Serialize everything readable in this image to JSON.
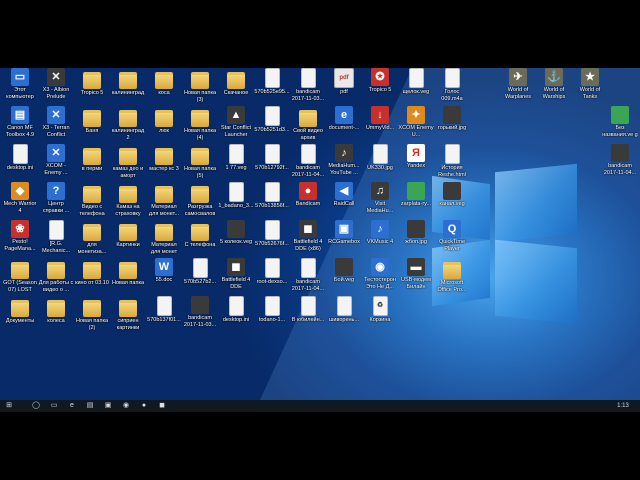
{
  "desktop": {
    "icons": [
      {
        "label": "Этот компьютер",
        "name": "this-pc-icon",
        "glyph": "▭",
        "style": "g-app"
      },
      {
        "label": "X3 - Albion Prelude",
        "name": "x3-albion-icon",
        "glyph": "✕",
        "style": "g-dark"
      },
      {
        "label": "Tropico 5",
        "name": "tropico5-shortcut-icon",
        "glyph": "",
        "style": "g-folder"
      },
      {
        "label": "калининград",
        "name": "folder-icon",
        "glyph": "",
        "style": "g-folder"
      },
      {
        "label": "коса",
        "name": "folder-icon",
        "glyph": "",
        "style": "g-folder"
      },
      {
        "label": "Новая папка (3)",
        "name": "folder-icon",
        "glyph": "",
        "style": "g-folder"
      },
      {
        "label": "Скачаное",
        "name": "folder-icon",
        "glyph": "",
        "style": "g-folder"
      },
      {
        "label": "570b525e95...",
        "name": "file-icon",
        "glyph": "",
        "style": "g-file"
      },
      {
        "label": "bandicam 2017-11-03...",
        "name": "video-file-icon",
        "glyph": "",
        "style": "g-file"
      },
      {
        "label": "pdf",
        "name": "pdf-file-icon",
        "glyph": "pdf",
        "style": "g-pdf"
      },
      {
        "label": "Tropico 5",
        "name": "tropico5-icon",
        "glyph": "✪",
        "style": "g-red"
      },
      {
        "label": "щелок.veg",
        "name": "veg-file-icon",
        "glyph": "",
        "style": "g-file"
      },
      {
        "label": "Голос 009.m4a",
        "name": "audio-file-icon",
        "glyph": "",
        "style": "g-file"
      },
      {
        "label": "World of Warplanes",
        "name": "wowp-icon",
        "glyph": "✈",
        "style": "g-wot"
      },
      {
        "label": "World of Warships",
        "name": "wows-icon",
        "glyph": "⚓",
        "style": "g-wot"
      },
      {
        "label": "World of Tanks",
        "name": "wot-icon",
        "glyph": "★",
        "style": "g-wot"
      },
      {
        "label": "Canon MF Toolbox 4.9",
        "name": "canon-icon",
        "glyph": "▤",
        "style": "g-app"
      },
      {
        "label": "X3 - Terran Conflict",
        "name": "x3-terran-icon",
        "glyph": "✕",
        "style": "g-app"
      },
      {
        "label": "Баня",
        "name": "folder-icon",
        "glyph": "",
        "style": "g-folder"
      },
      {
        "label": "калининград 2",
        "name": "folder-icon",
        "glyph": "",
        "style": "g-folder"
      },
      {
        "label": "люк",
        "name": "folder-icon",
        "glyph": "",
        "style": "g-folder"
      },
      {
        "label": "Новая папка (4)",
        "name": "folder-icon",
        "glyph": "",
        "style": "g-folder"
      },
      {
        "label": "Star Conflict Launcher",
        "name": "star-conflict-icon",
        "glyph": "▲",
        "style": "g-dark"
      },
      {
        "label": "570b5251d3...",
        "name": "file-icon",
        "glyph": "",
        "style": "g-file"
      },
      {
        "label": "Свой видео архив",
        "name": "folder-icon",
        "glyph": "",
        "style": "g-folder"
      },
      {
        "label": "document-...",
        "name": "ie-icon",
        "glyph": "e",
        "style": "g-app"
      },
      {
        "label": "UmmyVid...",
        "name": "ummy-icon",
        "glyph": "↓",
        "style": "g-red"
      },
      {
        "label": "XCOM Enemy U...",
        "name": "xcom-eu-icon",
        "glyph": "✦",
        "style": "g-orange"
      },
      {
        "label": "горький.jpg",
        "name": "image-file-icon",
        "glyph": "",
        "style": "g-dark"
      },
      {
        "label": "Без названия.ve g",
        "name": "veg-file-selected-icon",
        "glyph": "",
        "style": "g-green"
      },
      {
        "label": "desktop.ini",
        "name": "ini-file-icon",
        "glyph": "",
        "style": "g-file"
      },
      {
        "label": "XCOM - Enemy ...",
        "name": "xcom-icon",
        "glyph": "✕",
        "style": "g-app"
      },
      {
        "label": "в перми",
        "name": "folder-icon",
        "glyph": "",
        "style": "g-folder"
      },
      {
        "label": "камаз део и аморт",
        "name": "folder-icon",
        "glyph": "",
        "style": "g-folder"
      },
      {
        "label": "мастер кс 3",
        "name": "folder-icon",
        "glyph": "",
        "style": "g-folder"
      },
      {
        "label": "Новая папка (5)",
        "name": "folder-icon",
        "glyph": "",
        "style": "g-folder"
      },
      {
        "label": "1 77.veg",
        "name": "veg-file-icon",
        "glyph": "",
        "style": "g-file"
      },
      {
        "label": "570b12792f...",
        "name": "file-icon",
        "glyph": "",
        "style": "g-file"
      },
      {
        "label": "bandicam 2017-11-04...",
        "name": "video-file-icon",
        "glyph": "",
        "style": "g-file"
      },
      {
        "label": "MediaHum... YouTube ...",
        "name": "mediahuman-icon",
        "glyph": "♪",
        "style": "g-dark"
      },
      {
        "label": "UK330.jpg",
        "name": "image-file-icon",
        "glyph": "",
        "style": "g-file"
      },
      {
        "label": "Yandex",
        "name": "yandex-icon",
        "glyph": "Я",
        "style": "g-yandex"
      },
      {
        "label": "История Reshe.html",
        "name": "html-file-icon",
        "glyph": "",
        "style": "g-file"
      },
      {
        "label": "bandicam 2017-11-04...",
        "name": "video-file-icon",
        "glyph": "",
        "style": "g-dark"
      },
      {
        "label": "Mech Warrior 4",
        "name": "mechwarrior-icon",
        "glyph": "◆",
        "style": "g-orange"
      },
      {
        "label": "Центр справки ...",
        "name": "help-center-icon",
        "glyph": "?",
        "style": "g-app"
      },
      {
        "label": "Видео с телефона",
        "name": "folder-icon",
        "glyph": "",
        "style": "g-folder"
      },
      {
        "label": "Камаз на страховку",
        "name": "folder-icon",
        "glyph": "",
        "style": "g-folder"
      },
      {
        "label": "Материал для монет...",
        "name": "folder-icon",
        "glyph": "",
        "style": "g-folder"
      },
      {
        "label": "Разгрузка самосвалов",
        "name": "folder-icon",
        "glyph": "",
        "style": "g-folder"
      },
      {
        "label": "1_badano_3...",
        "name": "file-icon",
        "glyph": "",
        "style": "g-file"
      },
      {
        "label": "570b13856f...",
        "name": "file-icon",
        "glyph": "",
        "style": "g-file"
      },
      {
        "label": "Bandicam",
        "name": "bandicam-icon",
        "glyph": "●",
        "style": "g-red"
      },
      {
        "label": "RaidCall",
        "name": "raidcall-icon",
        "glyph": "◀",
        "style": "g-app"
      },
      {
        "label": "Visit MediaHu...",
        "name": "mediahuman-visit-icon",
        "glyph": "♫",
        "style": "g-dark"
      },
      {
        "label": "zarplata-ry...",
        "name": "spreadsheet-file-icon",
        "glyph": "",
        "style": "g-green"
      },
      {
        "label": "канал.veg",
        "name": "veg-file-icon",
        "glyph": "",
        "style": "g-dark"
      },
      {
        "label": "Pesto! PageMana...",
        "name": "presto-icon",
        "glyph": "❀",
        "style": "g-red"
      },
      {
        "label": "[R.G. Mechanic...",
        "name": "file-icon",
        "glyph": "",
        "style": "g-file"
      },
      {
        "label": "для монетиза...",
        "name": "folder-icon",
        "glyph": "",
        "style": "g-folder"
      },
      {
        "label": "Картинки",
        "name": "folder-icon",
        "glyph": "",
        "style": "g-folder"
      },
      {
        "label": "Материал для монет",
        "name": "folder-icon",
        "glyph": "",
        "style": "g-folder"
      },
      {
        "label": "С телефона",
        "name": "folder-icon",
        "glyph": "",
        "style": "g-folder"
      },
      {
        "label": "5 колеок.veg",
        "name": "veg-file-icon",
        "glyph": "",
        "style": "g-dark"
      },
      {
        "label": "570b52676f...",
        "name": "file-icon",
        "glyph": "",
        "style": "g-file"
      },
      {
        "label": "Battlefield 4 DDE (x86)",
        "name": "battlefield-icon",
        "glyph": "◼",
        "style": "g-dark"
      },
      {
        "label": "RCGamebox",
        "name": "rcgamebox-icon",
        "glyph": "▣",
        "style": "g-app"
      },
      {
        "label": "VKMusic 4",
        "name": "vkmusic-icon",
        "glyph": "♪",
        "style": "g-app"
      },
      {
        "label": "жбоп.jpg",
        "name": "image-file-icon",
        "glyph": "",
        "style": "g-dark"
      },
      {
        "label": "QuickTime Player",
        "name": "quicktime-icon",
        "glyph": "Q",
        "style": "g-app"
      },
      {
        "label": "GOT (Season 07) LOST",
        "name": "folder-icon",
        "glyph": "",
        "style": "g-folder"
      },
      {
        "label": "Для работы с видео о ...",
        "name": "folder-icon",
        "glyph": "",
        "style": "g-folder"
      },
      {
        "label": "кино от 03.10",
        "name": "folder-icon",
        "glyph": "",
        "style": "g-folder"
      },
      {
        "label": "Новая папка",
        "name": "folder-icon",
        "glyph": "",
        "style": "g-folder"
      },
      {
        "label": "55.doc",
        "name": "word-file-icon",
        "glyph": "W",
        "style": "g-app"
      },
      {
        "label": "570b527b2...",
        "name": "file-icon",
        "glyph": "",
        "style": "g-file"
      },
      {
        "label": "Battlefield 4 DDE",
        "name": "battlefield-icon",
        "glyph": "◼",
        "style": "g-dark"
      },
      {
        "label": "root-dexso...",
        "name": "file-icon",
        "glyph": "",
        "style": "g-file"
      },
      {
        "label": "bandicam 2017-11-04...",
        "name": "video-file-icon",
        "glyph": "",
        "style": "g-file"
      },
      {
        "label": "Бой.veg",
        "name": "veg-file-icon",
        "glyph": "",
        "style": "g-dark"
      },
      {
        "label": "Тестостерон Это Не Д...",
        "name": "chrome-icon",
        "glyph": "◉",
        "style": "g-app"
      },
      {
        "label": "USB-модем Билайн",
        "name": "usb-modem-icon",
        "glyph": "▬",
        "style": "g-dark"
      },
      {
        "label": "Microsoft Office Pro...",
        "name": "folder-icon",
        "glyph": "",
        "style": "g-folder"
      },
      {
        "label": "Документы",
        "name": "folder-icon",
        "glyph": "",
        "style": "g-folder"
      },
      {
        "label": "колеса",
        "name": "folder-icon",
        "glyph": "",
        "style": "g-folder"
      },
      {
        "label": "Новая папка (2)",
        "name": "folder-icon",
        "glyph": "",
        "style": "g-folder"
      },
      {
        "label": "сиприен картинки",
        "name": "folder-icon",
        "glyph": "",
        "style": "g-folder"
      },
      {
        "label": "570b137f01...",
        "name": "file-icon",
        "glyph": "",
        "style": "g-file"
      },
      {
        "label": "bandicam 2017-11-03...",
        "name": "video-file-icon",
        "glyph": "",
        "style": "g-dark"
      },
      {
        "label": "desktop.ini",
        "name": "ini-file-icon",
        "glyph": "",
        "style": "g-file"
      },
      {
        "label": "todano-1...",
        "name": "file-icon",
        "glyph": "",
        "style": "g-file"
      },
      {
        "label": "В юбилейн...",
        "name": "word-file-icon",
        "glyph": "",
        "style": "g-file"
      },
      {
        "label": "шиворень...",
        "name": "file-icon",
        "glyph": "",
        "style": "g-file"
      },
      {
        "label": "Корзина",
        "name": "recycle-bin-icon",
        "glyph": "♻",
        "style": "g-file"
      }
    ]
  },
  "taskbar": {
    "start_glyph": "⊞",
    "apps": [
      "◯",
      "▭",
      "e",
      "▤",
      "▣",
      "◉",
      "●",
      "◼"
    ],
    "clock": "1:13"
  }
}
